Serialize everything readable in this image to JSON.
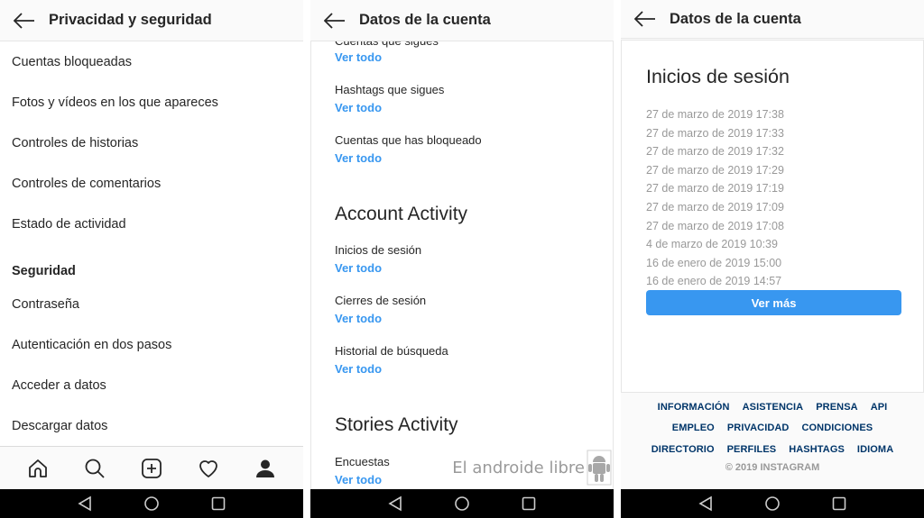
{
  "panel1": {
    "title": "Privacidad y seguridad",
    "items": [
      {
        "label": "Cuentas bloqueadas"
      },
      {
        "label": "Fotos y vídeos en los que apareces"
      },
      {
        "label": "Controles de historias"
      },
      {
        "label": "Controles de comentarios"
      },
      {
        "label": "Estado de actividad"
      }
    ],
    "section_security": "Seguridad",
    "security_items": [
      {
        "label": "Contraseña"
      },
      {
        "label": "Autenticación en dos pasos"
      },
      {
        "label": "Acceder a datos"
      },
      {
        "label": "Descargar datos"
      }
    ],
    "tabbar": [
      "home-icon",
      "search-icon",
      "add-post-icon",
      "heart-icon",
      "profile-icon"
    ]
  },
  "panel2": {
    "title": "Datos de la cuenta",
    "clipped_label": "Cuentas que sigues",
    "link_label": "Ver todo",
    "top_items": [
      {
        "label": "Hashtags que sigues"
      },
      {
        "label": "Cuentas que has bloqueado"
      }
    ],
    "account_activity_heading": "Account Activity",
    "account_activity_items": [
      {
        "label": "Inicios de sesión"
      },
      {
        "label": "Cierres de sesión"
      },
      {
        "label": "Historial de búsqueda"
      }
    ],
    "stories_activity_heading": "Stories Activity",
    "stories_items": [
      {
        "label": "Encuestas"
      }
    ],
    "watermark": "El androide libre"
  },
  "panel3": {
    "title": "Datos de la cuenta",
    "heading": "Inicios de sesión",
    "logins": [
      "27 de marzo de 2019 17:38",
      "27 de marzo de 2019 17:33",
      "27 de marzo de 2019 17:32",
      "27 de marzo de 2019 17:29",
      "27 de marzo de 2019 17:19",
      "27 de marzo de 2019 17:09",
      "27 de marzo de 2019 17:08",
      "4 de marzo de 2019 10:39",
      "16 de enero de 2019 15:00",
      "16 de enero de 2019 14:57"
    ],
    "more_button": "Ver más",
    "footer_rows": [
      [
        "INFORMACIÓN",
        "ASISTENCIA",
        "PRENSA",
        "API"
      ],
      [
        "EMPLEO",
        "PRIVACIDAD",
        "CONDICIONES"
      ],
      [
        "DIRECTORIO",
        "PERFILES",
        "HASHTAGS",
        "IDIOMA"
      ]
    ],
    "copyright": "© 2019 INSTAGRAM"
  },
  "colors": {
    "link_blue": "#3897f0",
    "footer_link": "#003569",
    "muted": "#999999"
  }
}
